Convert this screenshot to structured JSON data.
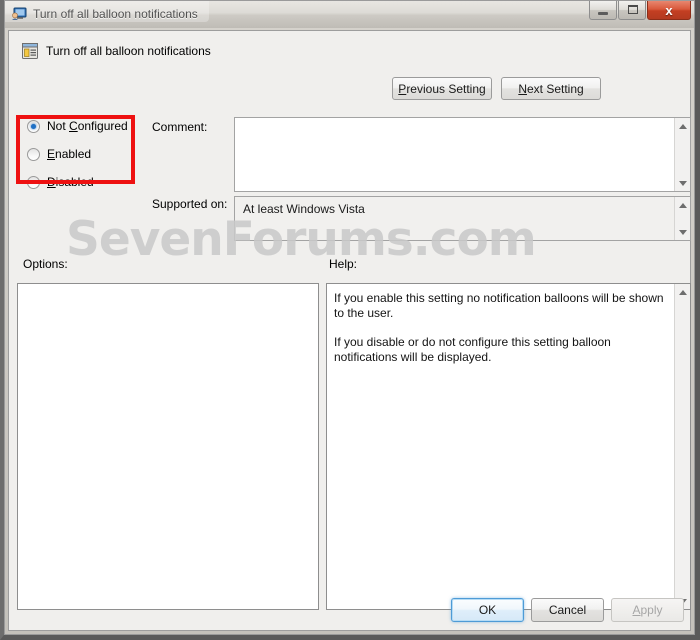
{
  "window": {
    "title": "Turn off all balloon notifications",
    "icon": "policy-user-monitor-icon",
    "buttons": {
      "minimize": "minimize-icon",
      "maximize": "maximize-icon",
      "close": "x"
    }
  },
  "header": {
    "setting_name": "Turn off all balloon notifications",
    "icon": "policy-setting-icon",
    "previous_label_pre": "P",
    "previous_label_post": "revious Setting",
    "next_label_pre": "N",
    "next_label_post": "ext Setting"
  },
  "state": {
    "selected": "Not Configured",
    "options": [
      {
        "label_pre": "Not ",
        "label_acc": "C",
        "label_post": "onfigured",
        "checked": true
      },
      {
        "label_pre": "",
        "label_acc": "E",
        "label_post": "nabled",
        "checked": false
      },
      {
        "label_pre": "",
        "label_acc": "D",
        "label_post": "isabled",
        "checked": false
      }
    ]
  },
  "fields": {
    "comment_label": "Comment:",
    "comment_value": "",
    "comment_placeholder": "",
    "supported_label": "Supported on:",
    "supported_value": "At least Windows Vista"
  },
  "panels": {
    "options_label": "Options:",
    "help_label": "Help:",
    "options_content": "",
    "help_paragraphs": [
      "If you enable this setting no notification balloons will be shown to the user.",
      "If you disable or do not configure this setting balloon notifications will be displayed."
    ]
  },
  "footer": {
    "ok_label": "OK",
    "cancel_label": "Cancel",
    "apply_label_pre": "A",
    "apply_label_post": "pply",
    "apply_disabled": true
  },
  "overlay": {
    "watermark": "SevenForums.com",
    "annotation_color": "#ee1111"
  }
}
